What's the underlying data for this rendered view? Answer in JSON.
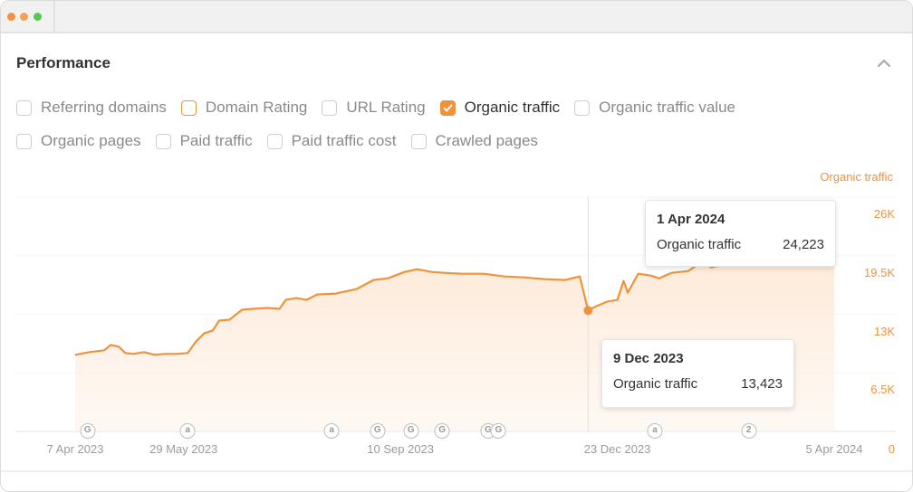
{
  "window": {
    "controls": [
      "close",
      "minimize",
      "maximize"
    ]
  },
  "panel": {
    "title": "Performance",
    "collapse_icon": "chevron-up-icon"
  },
  "metrics": {
    "row1": [
      {
        "label": "Referring domains",
        "checked": false,
        "style": "default"
      },
      {
        "label": "Domain Rating",
        "checked": false,
        "style": "orange-outline"
      },
      {
        "label": "URL Rating",
        "checked": false,
        "style": "default"
      },
      {
        "label": "Organic traffic",
        "checked": true,
        "style": "checked"
      },
      {
        "label": "Organic traffic value",
        "checked": false,
        "style": "default"
      }
    ],
    "row2": [
      {
        "label": "Organic pages",
        "checked": false,
        "style": "default"
      },
      {
        "label": "Paid traffic",
        "checked": false,
        "style": "default"
      },
      {
        "label": "Paid traffic cost",
        "checked": false,
        "style": "default"
      },
      {
        "label": "Crawled pages",
        "checked": false,
        "style": "default"
      }
    ]
  },
  "tooltips": [
    {
      "date": "1 Apr 2024",
      "metric": "Organic traffic",
      "value": "24,223"
    },
    {
      "date": "9 Dec 2023",
      "metric": "Organic traffic",
      "value": "13,423"
    }
  ],
  "colors": {
    "accent": "#f0923a",
    "fill": "#fde7d4",
    "grid": "#e6e6e6",
    "axis_text": "#9a9a9a"
  },
  "chart_data": {
    "type": "area",
    "title": "",
    "series": [
      {
        "name": "Organic traffic",
        "color": "#f0923a",
        "points": [
          [
            "2023-04-07",
            8500
          ],
          [
            "2023-04-14",
            8800
          ],
          [
            "2023-04-21",
            9000
          ],
          [
            "2023-04-24",
            9600
          ],
          [
            "2023-04-28",
            9400
          ],
          [
            "2023-05-01",
            8700
          ],
          [
            "2023-05-05",
            8600
          ],
          [
            "2023-05-10",
            8800
          ],
          [
            "2023-05-15",
            8500
          ],
          [
            "2023-05-20",
            8600
          ],
          [
            "2023-05-26",
            8600
          ],
          [
            "2023-05-31",
            8700
          ],
          [
            "2023-06-04",
            10000
          ],
          [
            "2023-06-08",
            10900
          ],
          [
            "2023-06-12",
            11200
          ],
          [
            "2023-06-15",
            12300
          ],
          [
            "2023-06-20",
            12400
          ],
          [
            "2023-06-26",
            13500
          ],
          [
            "2023-07-01",
            13600
          ],
          [
            "2023-07-08",
            13700
          ],
          [
            "2023-07-14",
            13600
          ],
          [
            "2023-07-17",
            14600
          ],
          [
            "2023-07-22",
            14800
          ],
          [
            "2023-07-27",
            14600
          ],
          [
            "2023-08-01",
            15200
          ],
          [
            "2023-08-10",
            15300
          ],
          [
            "2023-08-20",
            15800
          ],
          [
            "2023-08-28",
            16800
          ],
          [
            "2023-09-04",
            17000
          ],
          [
            "2023-09-12",
            17700
          ],
          [
            "2023-09-18",
            18000
          ],
          [
            "2023-09-25",
            17700
          ],
          [
            "2023-10-01",
            17600
          ],
          [
            "2023-10-10",
            17500
          ],
          [
            "2023-10-20",
            17500
          ],
          [
            "2023-10-30",
            17200
          ],
          [
            "2023-11-08",
            17100
          ],
          [
            "2023-11-18",
            16900
          ],
          [
            "2023-11-28",
            16800
          ],
          [
            "2023-12-05",
            17200
          ],
          [
            "2023-12-09",
            13423
          ],
          [
            "2023-12-12",
            13800
          ],
          [
            "2023-12-18",
            14400
          ],
          [
            "2023-12-23",
            14600
          ],
          [
            "2023-12-26",
            16700
          ],
          [
            "2023-12-28",
            15400
          ],
          [
            "2024-01-02",
            17500
          ],
          [
            "2024-01-08",
            17300
          ],
          [
            "2024-01-12",
            17000
          ],
          [
            "2024-01-18",
            17600
          ],
          [
            "2024-01-26",
            17800
          ],
          [
            "2024-02-02",
            18900
          ],
          [
            "2024-02-06",
            18200
          ],
          [
            "2024-02-12",
            18500
          ],
          [
            "2024-02-20",
            19500
          ],
          [
            "2024-02-28",
            19700
          ],
          [
            "2024-03-08",
            20000
          ],
          [
            "2024-03-18",
            20200
          ],
          [
            "2024-03-26",
            20500
          ],
          [
            "2024-04-01",
            24223
          ]
        ]
      }
    ],
    "x_tick_labels": [
      "7 Apr 2023",
      "29 May 2023",
      "10 Sep 2023",
      "23 Dec 2023",
      "5 Apr 2024"
    ],
    "y_tick_labels": [
      "0",
      "6.5K",
      "13K",
      "19.5K",
      "26K"
    ],
    "ylabel": "Organic traffic",
    "ylim": [
      0,
      26000
    ],
    "xlim": [
      "2023-03-18",
      "2024-04-20"
    ],
    "grid": true,
    "y_axis_position": "right",
    "highlighted_point": {
      "date": "2023-12-09",
      "value": 13423
    },
    "annotations": [
      {
        "type": "G",
        "date": "2023-04-13"
      },
      {
        "type": "a",
        "date": "2023-05-31"
      },
      {
        "type": "a",
        "date": "2023-08-08"
      },
      {
        "type": "G",
        "date": "2023-08-30"
      },
      {
        "type": "G",
        "date": "2023-09-15"
      },
      {
        "type": "G",
        "date": "2023-09-30"
      },
      {
        "type": "G",
        "date": "2023-10-22"
      },
      {
        "type": "G",
        "date": "2023-10-27"
      },
      {
        "type": "a",
        "date": "2024-01-10"
      },
      {
        "type": "2",
        "date": "2024-02-24"
      }
    ]
  }
}
